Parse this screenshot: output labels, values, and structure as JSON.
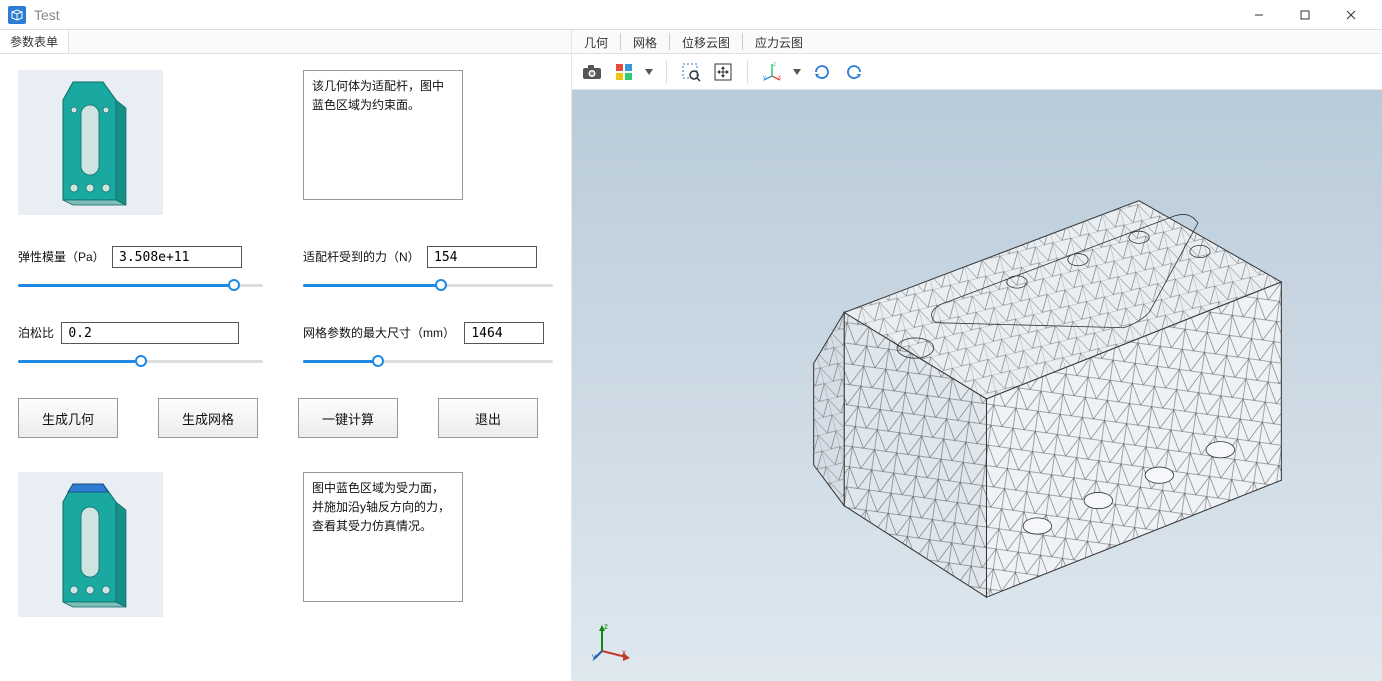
{
  "window": {
    "title": "Test"
  },
  "left": {
    "tab_label": "参数表单",
    "desc1": "该几何体为适配杆，图中蓝色区域为约束面。",
    "desc2": "图中蓝色区域为受力面，并施加沿y轴反方向的力，查看其受力仿真情况。",
    "params": {
      "elastic_label": "弹性模量（Pa）",
      "elastic_value": "3.508e+11",
      "force_label": "适配杆受到的力（N）",
      "force_value": "154",
      "poisson_label": "泊松比",
      "poisson_value": "0.2",
      "mesh_label": "网格参数的最大尺寸（mm）",
      "mesh_value": "1464"
    },
    "buttons": {
      "gen_geom": "生成几何",
      "gen_mesh": "生成网格",
      "compute": "一键计算",
      "exit": "退出"
    }
  },
  "right": {
    "tabs": [
      "几何",
      "网格",
      "位移云图",
      "应力云图"
    ],
    "toolbar_icons": {
      "camera": "camera-icon",
      "grid": "multiview-icon",
      "zoom_select": "zoom-region-icon",
      "fit": "fit-view-icon",
      "axes": "axes-icon",
      "rotate_cw": "rotate-cw-icon",
      "rotate_ccw": "rotate-ccw-icon"
    }
  }
}
